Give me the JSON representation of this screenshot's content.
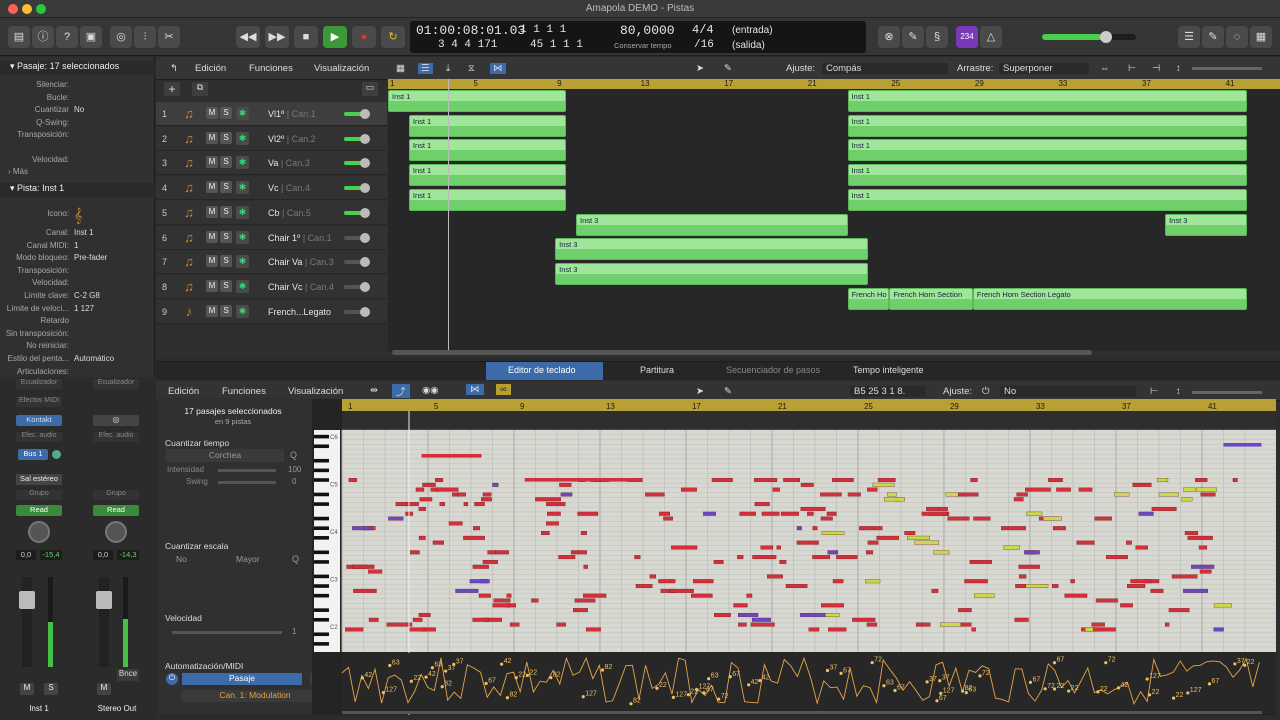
{
  "window": {
    "title": "Amapola DEMO - Pistas"
  },
  "lcd": {
    "time": "01:00:08:01.03",
    "bars_top": "1  1  1     1",
    "bars_bottom": "3  4  4  171",
    "pos_bottom": "45  1  1     1",
    "tempo": "80,0000",
    "tempo_label": "Conservar tempo",
    "sig_top": "4/4",
    "sig_bottom": "/16",
    "in_label": "(entrada)",
    "out_label": "(salida)",
    "counter": "234"
  },
  "inspector": {
    "region_header": "Pasaje:",
    "region_sel": "17 seleccionados",
    "rows_top": [
      {
        "k": "Silenciar:",
        "v": ""
      },
      {
        "k": "Bucle:",
        "v": ""
      },
      {
        "k": "Cuantizar",
        "v": "No"
      },
      {
        "k": "Q-Swing:",
        "v": ""
      },
      {
        "k": "Transposición:",
        "v": ""
      },
      {
        "k": "Velocidad:",
        "v": ""
      }
    ],
    "more": "Más",
    "track_header": "Pista:",
    "track_name": "Inst 1",
    "rows_track": [
      {
        "k": "Icono:",
        "v": ""
      },
      {
        "k": "Canal:",
        "v": "Inst 1"
      },
      {
        "k": "Canal MIDI:",
        "v": "1"
      },
      {
        "k": "Modo bloqueo:",
        "v": "Pre-fader"
      },
      {
        "k": "Transposición:",
        "v": ""
      },
      {
        "k": "Velocidad:",
        "v": ""
      },
      {
        "k": "Límite clave:",
        "v": "C-2  G8"
      },
      {
        "k": "Límite de veloci...",
        "v": "1  127"
      },
      {
        "k": "Retardo",
        "v": ""
      },
      {
        "k": "Sin transposición:",
        "v": ""
      },
      {
        "k": "No reiniciar:",
        "v": ""
      },
      {
        "k": "Estilo del penta...",
        "v": "Automático"
      },
      {
        "k": "Articulaciones:",
        "v": ""
      }
    ]
  },
  "track_menu": {
    "edit": "Edición",
    "functions": "Funciones",
    "view": "Visualización",
    "snap_label": "Ajuste:",
    "snap_value": "Compás",
    "drag_label": "Arrastre:",
    "drag_value": "Superponer"
  },
  "tracks": [
    {
      "n": "1",
      "name": "Vl1º",
      "ch": "Can.1"
    },
    {
      "n": "2",
      "name": "Vl2º",
      "ch": "Can.2"
    },
    {
      "n": "3",
      "name": "Va",
      "ch": "Can.3"
    },
    {
      "n": "4",
      "name": "Vc",
      "ch": "Can.4"
    },
    {
      "n": "5",
      "name": "Cb",
      "ch": "Can.5"
    },
    {
      "n": "6",
      "name": "Chair 1º",
      "ch": "Can.1"
    },
    {
      "n": "7",
      "name": "Chair Va",
      "ch": "Can.3"
    },
    {
      "n": "8",
      "name": "Chair Vc",
      "ch": "Can.4"
    },
    {
      "n": "9",
      "name": "French...Legato",
      "ch": ""
    }
  ],
  "ruler_marks": [
    "1",
    "5",
    "9",
    "13",
    "17",
    "21",
    "25",
    "29",
    "33",
    "37",
    "41"
  ],
  "regions": {
    "inst1": "Inst 1",
    "inst3": "Inst 3",
    "fh_short": "French Ho",
    "fh": "French Horn Section",
    "fh_legato": "French Horn Section Legato"
  },
  "editor_tabs": {
    "piano": "Editor de teclado",
    "score": "Partitura",
    "step": "Secuenciador de pasos",
    "tempo": "Tempo inteligente"
  },
  "editor_menu": {
    "edit": "Edición",
    "functions": "Funciones",
    "view": "Visualización",
    "pos": "B5   25 3 1 8.",
    "snap_label": "Ajuste:",
    "snap_value": "No"
  },
  "sidepane": {
    "sel_title": "17 pasajes seleccionados",
    "sel_sub": "en 9 pistas",
    "qt_title": "Cuantizar tiempo",
    "qt_value": "Corchea",
    "intensity_label": "Intensidad",
    "intensity_value": "100",
    "swing_label": "Swing",
    "swing_value": "0",
    "qs_title": "Cuantizar escala",
    "qs_no": "No",
    "qs_mode": "Mayor",
    "vel_title": "Velocidad",
    "vel_value": "1",
    "auto_title": "Automatización/MIDI",
    "auto_mode": "Pasaje",
    "auto_param": "Can. 1: Modulation"
  },
  "mixer": {
    "eq1": "Ecualizador",
    "eq2": "Ecualizador",
    "midifx": "Efectos MIDI",
    "plugin": "Kontakt",
    "fx1": "Efec. audio",
    "fx2": "Efec. audio",
    "bus": "Bus 1",
    "output": "Sal estéreo",
    "group": "Grupo",
    "group2": "Grupo",
    "read": "Read",
    "read2": "Read",
    "vol1": "0,0",
    "peak1": "-15,4",
    "vol2": "0,0",
    "peak2": "-14,3",
    "bounce": "Bnce",
    "name1": "Inst 1",
    "name2": "Stereo Out",
    "m": "M",
    "s": "S",
    "m2": "M"
  },
  "piano_ruler": [
    "1",
    "5",
    "9",
    "13",
    "17",
    "21",
    "25",
    "29",
    "33",
    "37",
    "41"
  ],
  "octave_labels": [
    "C6",
    "C5",
    "C4",
    "C3",
    "C2"
  ],
  "automation_values": [
    "72",
    "127",
    "67",
    "127",
    "82",
    "42",
    "37",
    "22",
    "63"
  ]
}
